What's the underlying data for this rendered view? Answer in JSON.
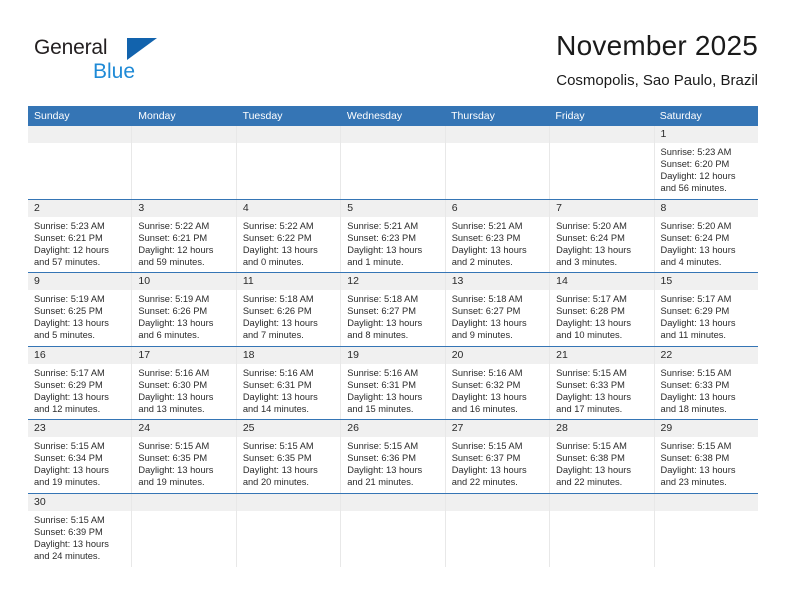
{
  "brand": {
    "name_top": "General",
    "name_bottom": "Blue",
    "accent_color": "#1263ad",
    "blue_text_color": "#1f8ad6"
  },
  "header": {
    "title": "November 2025",
    "subtitle": "Cosmopolis, Sao Paulo, Brazil"
  },
  "calendar": {
    "header_bg": "#3575b5",
    "header_text_color": "#ffffff",
    "daynum_bg": "#f0f0f0",
    "week_separator_color": "#3575b5",
    "weekdays": [
      "Sunday",
      "Monday",
      "Tuesday",
      "Wednesday",
      "Thursday",
      "Friday",
      "Saturday"
    ],
    "weeks": [
      [
        {
          "date": "",
          "info": ""
        },
        {
          "date": "",
          "info": ""
        },
        {
          "date": "",
          "info": ""
        },
        {
          "date": "",
          "info": ""
        },
        {
          "date": "",
          "info": ""
        },
        {
          "date": "",
          "info": ""
        },
        {
          "date": "1",
          "info": "Sunrise: 5:23 AM\nSunset: 6:20 PM\nDaylight: 12 hours\nand 56 minutes."
        }
      ],
      [
        {
          "date": "2",
          "info": "Sunrise: 5:23 AM\nSunset: 6:21 PM\nDaylight: 12 hours\nand 57 minutes."
        },
        {
          "date": "3",
          "info": "Sunrise: 5:22 AM\nSunset: 6:21 PM\nDaylight: 12 hours\nand 59 minutes."
        },
        {
          "date": "4",
          "info": "Sunrise: 5:22 AM\nSunset: 6:22 PM\nDaylight: 13 hours\nand 0 minutes."
        },
        {
          "date": "5",
          "info": "Sunrise: 5:21 AM\nSunset: 6:23 PM\nDaylight: 13 hours\nand 1 minute."
        },
        {
          "date": "6",
          "info": "Sunrise: 5:21 AM\nSunset: 6:23 PM\nDaylight: 13 hours\nand 2 minutes."
        },
        {
          "date": "7",
          "info": "Sunrise: 5:20 AM\nSunset: 6:24 PM\nDaylight: 13 hours\nand 3 minutes."
        },
        {
          "date": "8",
          "info": "Sunrise: 5:20 AM\nSunset: 6:24 PM\nDaylight: 13 hours\nand 4 minutes."
        }
      ],
      [
        {
          "date": "9",
          "info": "Sunrise: 5:19 AM\nSunset: 6:25 PM\nDaylight: 13 hours\nand 5 minutes."
        },
        {
          "date": "10",
          "info": "Sunrise: 5:19 AM\nSunset: 6:26 PM\nDaylight: 13 hours\nand 6 minutes."
        },
        {
          "date": "11",
          "info": "Sunrise: 5:18 AM\nSunset: 6:26 PM\nDaylight: 13 hours\nand 7 minutes."
        },
        {
          "date": "12",
          "info": "Sunrise: 5:18 AM\nSunset: 6:27 PM\nDaylight: 13 hours\nand 8 minutes."
        },
        {
          "date": "13",
          "info": "Sunrise: 5:18 AM\nSunset: 6:27 PM\nDaylight: 13 hours\nand 9 minutes."
        },
        {
          "date": "14",
          "info": "Sunrise: 5:17 AM\nSunset: 6:28 PM\nDaylight: 13 hours\nand 10 minutes."
        },
        {
          "date": "15",
          "info": "Sunrise: 5:17 AM\nSunset: 6:29 PM\nDaylight: 13 hours\nand 11 minutes."
        }
      ],
      [
        {
          "date": "16",
          "info": "Sunrise: 5:17 AM\nSunset: 6:29 PM\nDaylight: 13 hours\nand 12 minutes."
        },
        {
          "date": "17",
          "info": "Sunrise: 5:16 AM\nSunset: 6:30 PM\nDaylight: 13 hours\nand 13 minutes."
        },
        {
          "date": "18",
          "info": "Sunrise: 5:16 AM\nSunset: 6:31 PM\nDaylight: 13 hours\nand 14 minutes."
        },
        {
          "date": "19",
          "info": "Sunrise: 5:16 AM\nSunset: 6:31 PM\nDaylight: 13 hours\nand 15 minutes."
        },
        {
          "date": "20",
          "info": "Sunrise: 5:16 AM\nSunset: 6:32 PM\nDaylight: 13 hours\nand 16 minutes."
        },
        {
          "date": "21",
          "info": "Sunrise: 5:15 AM\nSunset: 6:33 PM\nDaylight: 13 hours\nand 17 minutes."
        },
        {
          "date": "22",
          "info": "Sunrise: 5:15 AM\nSunset: 6:33 PM\nDaylight: 13 hours\nand 18 minutes."
        }
      ],
      [
        {
          "date": "23",
          "info": "Sunrise: 5:15 AM\nSunset: 6:34 PM\nDaylight: 13 hours\nand 19 minutes."
        },
        {
          "date": "24",
          "info": "Sunrise: 5:15 AM\nSunset: 6:35 PM\nDaylight: 13 hours\nand 19 minutes."
        },
        {
          "date": "25",
          "info": "Sunrise: 5:15 AM\nSunset: 6:35 PM\nDaylight: 13 hours\nand 20 minutes."
        },
        {
          "date": "26",
          "info": "Sunrise: 5:15 AM\nSunset: 6:36 PM\nDaylight: 13 hours\nand 21 minutes."
        },
        {
          "date": "27",
          "info": "Sunrise: 5:15 AM\nSunset: 6:37 PM\nDaylight: 13 hours\nand 22 minutes."
        },
        {
          "date": "28",
          "info": "Sunrise: 5:15 AM\nSunset: 6:38 PM\nDaylight: 13 hours\nand 22 minutes."
        },
        {
          "date": "29",
          "info": "Sunrise: 5:15 AM\nSunset: 6:38 PM\nDaylight: 13 hours\nand 23 minutes."
        }
      ],
      [
        {
          "date": "30",
          "info": "Sunrise: 5:15 AM\nSunset: 6:39 PM\nDaylight: 13 hours\nand 24 minutes."
        },
        {
          "date": "",
          "info": ""
        },
        {
          "date": "",
          "info": ""
        },
        {
          "date": "",
          "info": ""
        },
        {
          "date": "",
          "info": ""
        },
        {
          "date": "",
          "info": ""
        },
        {
          "date": "",
          "info": ""
        }
      ]
    ]
  }
}
